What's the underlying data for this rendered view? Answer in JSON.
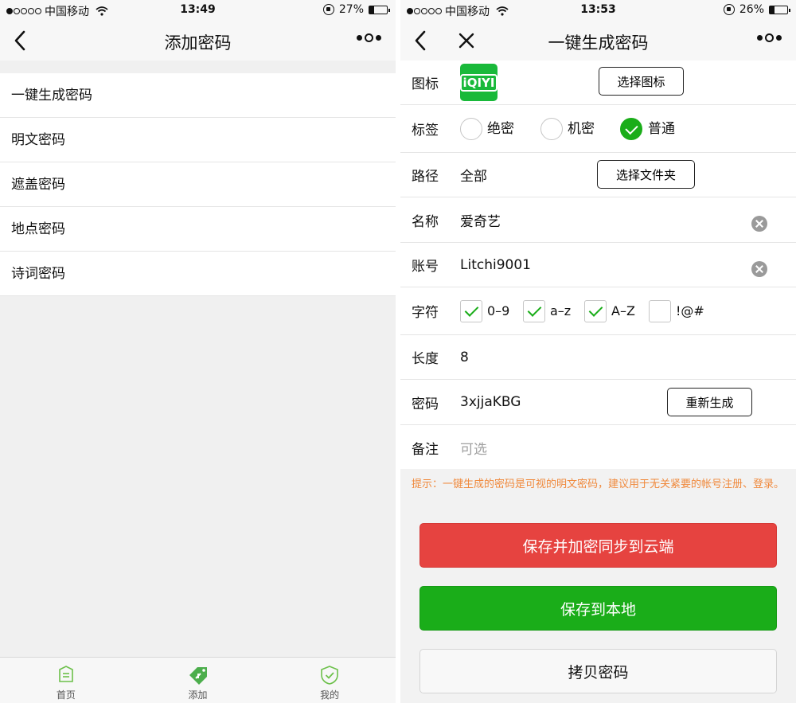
{
  "left": {
    "status": {
      "carrier": "中国移动",
      "time": "13:49",
      "battery": "27%",
      "battery_level": 0.27
    },
    "title": "添加密码",
    "menu": [
      {
        "label": "一键生成密码"
      },
      {
        "label": "明文密码"
      },
      {
        "label": "遮盖密码"
      },
      {
        "label": "地点密码"
      },
      {
        "label": "诗词密码"
      }
    ],
    "tabs": [
      {
        "label": "首页",
        "icon": "home-doc-icon"
      },
      {
        "label": "添加",
        "icon": "add-tag-icon"
      },
      {
        "label": "我的",
        "icon": "shield-check-icon"
      }
    ]
  },
  "right": {
    "status": {
      "carrier": "中国移动",
      "time": "13:53",
      "battery": "26%",
      "battery_level": 0.26
    },
    "title": "一键生成密码",
    "form": {
      "icon_label": "图标",
      "app_icon_text": "iQIYI",
      "choose_icon_label": "选择图标",
      "tag_label": "标签",
      "tags": [
        {
          "label": "绝密",
          "selected": false
        },
        {
          "label": "机密",
          "selected": false
        },
        {
          "label": "普通",
          "selected": true
        }
      ],
      "path_label": "路径",
      "path_value": "全部",
      "choose_folder_label": "选择文件夹",
      "name_label": "名称",
      "name_value": "爱奇艺",
      "account_label": "账号",
      "account_value": "Litchi9001",
      "chars_label": "字符",
      "chars": [
        {
          "label": "0–9",
          "checked": true
        },
        {
          "label": "a–z",
          "checked": true
        },
        {
          "label": "A–Z",
          "checked": true
        },
        {
          "label": "!@#",
          "checked": false
        }
      ],
      "length_label": "长度",
      "length_value": "8",
      "password_label": "密码",
      "password_value": "3xjjaKBG",
      "regenerate_label": "重新生成",
      "note_label": "备注",
      "note_placeholder": "可选"
    },
    "tip": "提示：一键生成的密码是可视的明文密码，建议用于无关紧要的帐号注册、登录。",
    "buttons": {
      "save_cloud": "保存并加密同步到云端",
      "save_local": "保存到本地",
      "copy": "拷贝密码"
    }
  },
  "colors": {
    "accent_green": "#1aad19",
    "danger_red": "#e64340",
    "tip_orange": "#f0893c"
  }
}
